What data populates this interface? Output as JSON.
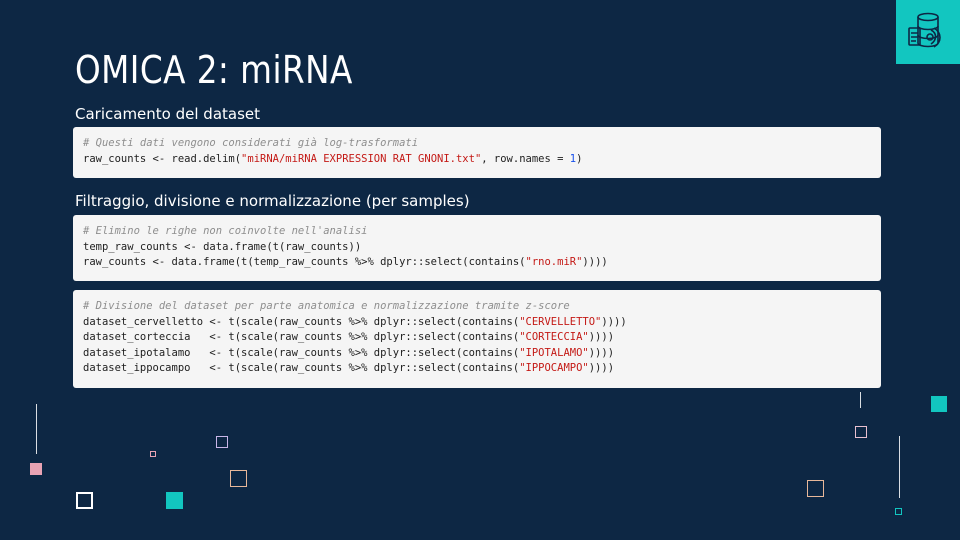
{
  "slide": {
    "title": "OMICA 2: miRNA",
    "section1_label": "Caricamento del dataset",
    "section2_label": "Filtraggio, divisione e normalizzazione (per samples)",
    "logo_icon": "omics-database-icon",
    "colors": {
      "background": "#0d2744",
      "accent": "#12c6c0",
      "code_background": "#f5f5f5",
      "string": "#c41a16",
      "comment": "#8e8e8e",
      "number": "#1750eb"
    }
  },
  "code1": {
    "comment": "# Questi dati vengono considerati già log-trasformati",
    "l1_pre": "raw_counts <- read.delim(",
    "l1_str": "\"miRNA/miRNA EXPRESSION RAT GNONI.txt\"",
    "l1_mid": ", row.names = ",
    "l1_num": "1",
    "l1_post": ")"
  },
  "code2": {
    "comment": "# Elimino le righe non coinvolte nell'analisi",
    "l1": "temp_raw_counts <- data.frame(t(raw_counts))",
    "l2_pre": "raw_counts <- data.frame(t(temp_raw_counts %>% dplyr::select(contains(",
    "l2_str": "\"rno.miR\"",
    "l2_post": "))))"
  },
  "code3": {
    "comment": "# Divisione del dataset per parte anatomica e normalizzazione tramite z-score",
    "lines": [
      {
        "pre": "dataset_cervelletto <- t(scale(raw_counts %>% dplyr::select(contains(",
        "str": "\"CERVELLETTO\"",
        "post": "))))"
      },
      {
        "pre": "dataset_corteccia   <- t(scale(raw_counts %>% dplyr::select(contains(",
        "str": "\"CORTECCIA\"",
        "post": "))))"
      },
      {
        "pre": "dataset_ipotalamo   <- t(scale(raw_counts %>% dplyr::select(contains(",
        "str": "\"IPOTALAMO\"",
        "post": "))))"
      },
      {
        "pre": "dataset_ippocampo   <- t(scale(raw_counts %>% dplyr::select(contains(",
        "str": "\"IPPOCAMPO\"",
        "post": "))))"
      }
    ]
  }
}
